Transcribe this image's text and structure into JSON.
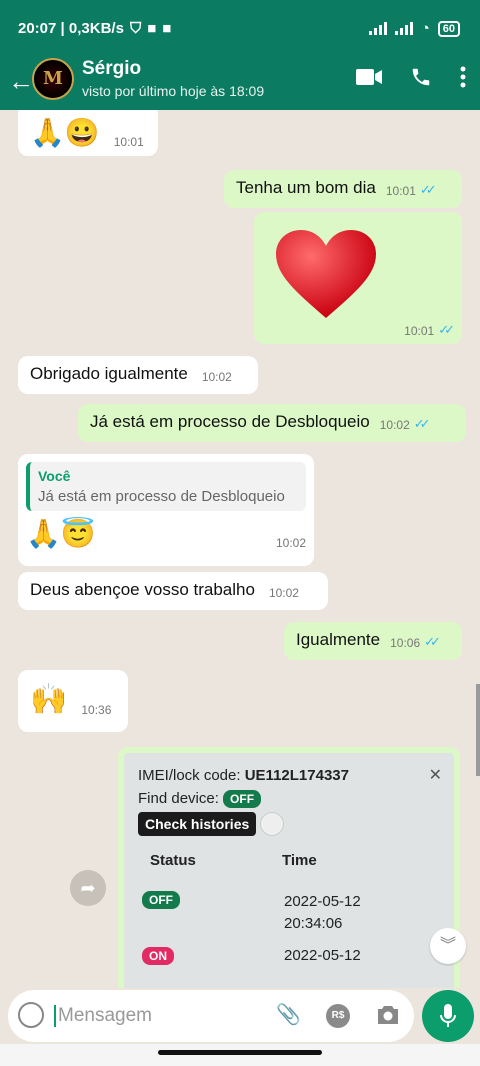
{
  "status": {
    "left": "20:07 | 0,3KB/s",
    "battery": "60"
  },
  "header": {
    "avatar_text": "M",
    "contact_name": "Sérgio",
    "last_seen": "visto por último hoje às 18:09",
    "back_icon": "arrow-left-icon",
    "video_icon": "video-call-icon",
    "call_icon": "phone-icon",
    "menu_icon": "more-vert-icon"
  },
  "messages": [
    {
      "id": "m1",
      "dir": "in",
      "text": "🙏😀",
      "time": "10:01"
    },
    {
      "id": "m2",
      "dir": "out",
      "text": "Tenha um bom dia",
      "time": "10:01"
    },
    {
      "id": "m3",
      "dir": "out",
      "text": "❤️",
      "time": "10:01"
    },
    {
      "id": "m4",
      "dir": "in",
      "text": "Obrigado igualmente",
      "time": "10:02"
    },
    {
      "id": "m5",
      "dir": "out",
      "text": "Já está em processo de Desbloqueio",
      "time": "10:02"
    },
    {
      "id": "m6",
      "dir": "in",
      "reply_to": "Você",
      "reply_text": "Já está em processo de Desbloqueio",
      "text": "🙏😇",
      "time": "10:02"
    },
    {
      "id": "m7",
      "dir": "in",
      "text": "Deus abençoe vosso trabalho",
      "time": "10:02"
    },
    {
      "id": "m8",
      "dir": "out",
      "text": "Igualmente",
      "time": "10:06"
    },
    {
      "id": "m9",
      "dir": "in",
      "text": "🙌",
      "time": "10:36"
    }
  ],
  "card": {
    "imei_label": "IMEI/lock code:",
    "imei_value": "UE112L174337",
    "find_device_label": "Find device:",
    "find_device_status": "OFF",
    "check_histories": "Check histories",
    "col_status": "Status",
    "col_time": "Time",
    "rows": [
      {
        "status": "OFF",
        "date": "2022-05-12",
        "time": "20:34:06"
      },
      {
        "status": "ON",
        "date": "2022-05-12",
        "time": ""
      }
    ],
    "close_icon": "close-icon"
  },
  "input": {
    "placeholder": "Mensagem",
    "rs_label": "R$"
  }
}
